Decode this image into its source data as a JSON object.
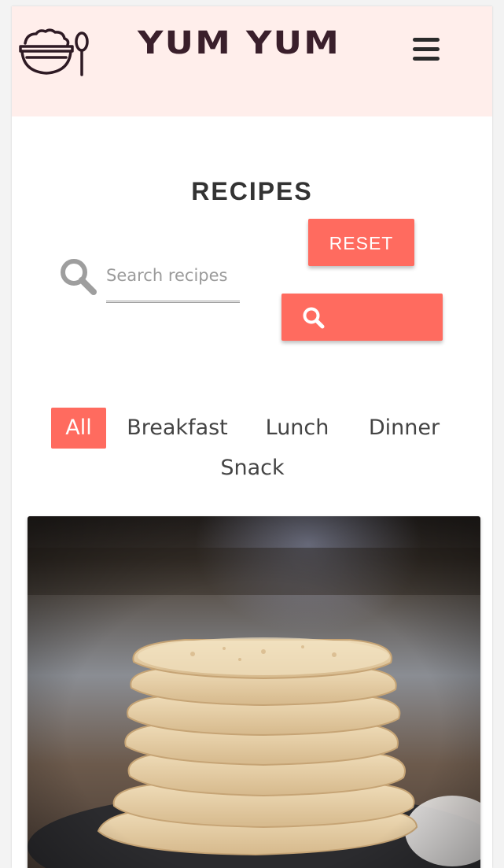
{
  "header": {
    "brand": "YUM YUM",
    "logo_icon": "bowl-and-spoon-icon",
    "menu_icon": "hamburger-menu-icon",
    "background": "#ffeeeb"
  },
  "recipes": {
    "title": "RECIPES",
    "search": {
      "placeholder": "Search recipes",
      "value": "",
      "icon": "search-icon"
    },
    "reset_label": "RESET",
    "search_button_icon": "search-icon",
    "accent_color": "#ff6b5f"
  },
  "filters": {
    "items": [
      {
        "label": "All",
        "active": true
      },
      {
        "label": "Breakfast",
        "active": false
      },
      {
        "label": "Lunch",
        "active": false
      },
      {
        "label": "Dinner",
        "active": false
      },
      {
        "label": "Snack",
        "active": false
      }
    ]
  },
  "cards": [
    {
      "image": "stack-of-pancakes-photo"
    }
  ]
}
